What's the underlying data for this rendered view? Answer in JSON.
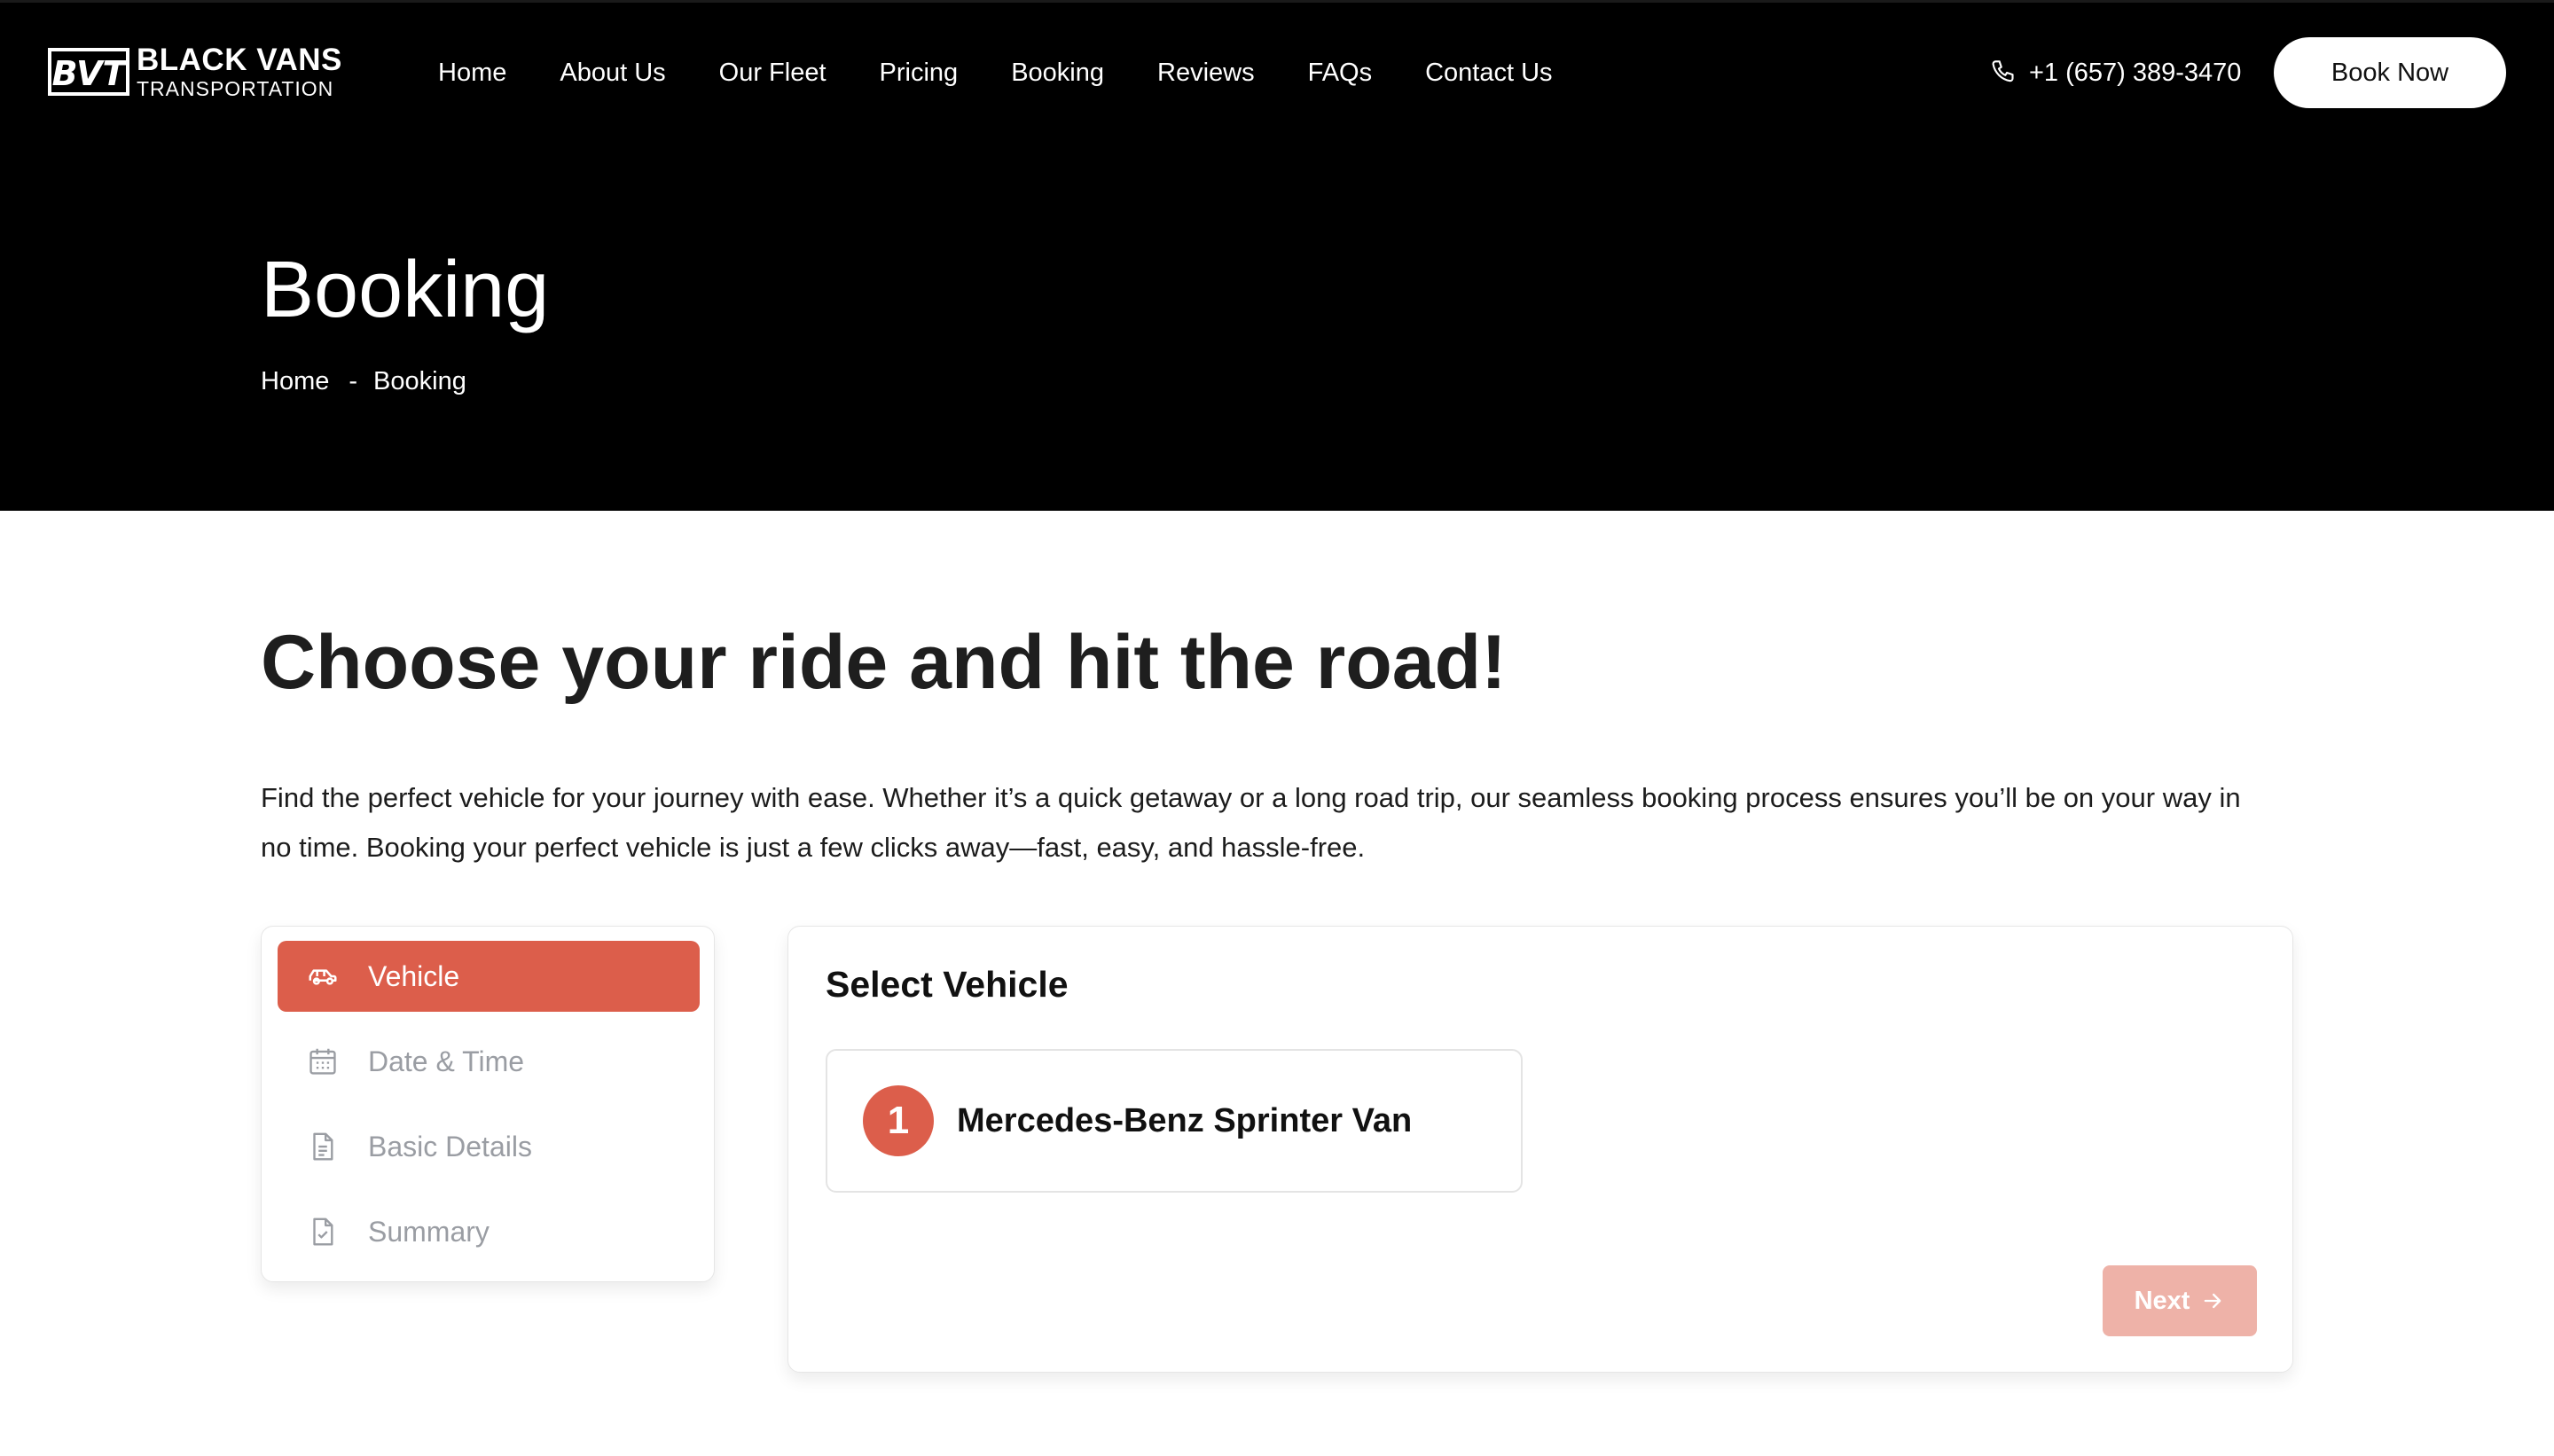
{
  "logo": {
    "line1": "BLACK VANS",
    "line2": "TRANSPORTATION",
    "mark_text": "BVT"
  },
  "nav": {
    "items": [
      {
        "label": "Home"
      },
      {
        "label": "About Us"
      },
      {
        "label": "Our Fleet"
      },
      {
        "label": "Pricing"
      },
      {
        "label": "Booking"
      },
      {
        "label": "Reviews"
      },
      {
        "label": "FAQs"
      },
      {
        "label": "Contact Us"
      }
    ],
    "phone": "+1 (657) 389-3470",
    "book_now_label": "Book Now"
  },
  "hero": {
    "title": "Booking",
    "breadcrumb": {
      "home": "Home",
      "separator": "-",
      "current": "Booking"
    }
  },
  "main": {
    "heading": "Choose your ride and hit the road!",
    "intro": "Find the perfect vehicle for your journey with ease. Whether it’s a quick getaway or a long road trip, our seamless booking process ensures you’ll be on your way in no time. Booking your perfect vehicle is just a few clicks away—fast, easy, and hassle-free."
  },
  "steps": [
    {
      "label": "Vehicle",
      "icon": "car-icon",
      "active": true
    },
    {
      "label": "Date & Time",
      "icon": "calendar-icon",
      "active": false
    },
    {
      "label": "Basic Details",
      "icon": "document-icon",
      "active": false
    },
    {
      "label": "Summary",
      "icon": "document-check-icon",
      "active": false
    }
  ],
  "panel": {
    "title": "Select Vehicle",
    "vehicles": [
      {
        "number": "1",
        "name": "Mercedes-Benz Sprinter Van"
      }
    ],
    "next_label": "Next"
  },
  "colors": {
    "accent": "#dc5e4b",
    "accent_disabled": "#eeb2a8",
    "hero_bg": "#000000",
    "muted_text": "#9a9da3"
  }
}
